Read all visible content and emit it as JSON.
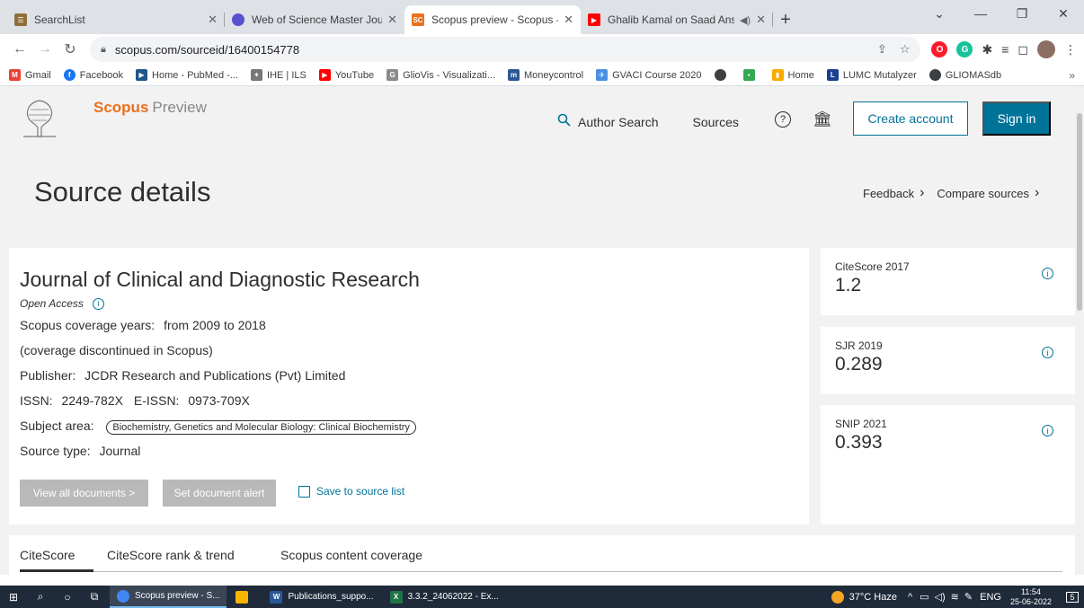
{
  "browser": {
    "tabs": [
      {
        "title": "SearchList",
        "favicon": "searchlist-icon",
        "favicon_color": "#8e6f3a",
        "active": false
      },
      {
        "title": "Web of Science Master Journal Li",
        "favicon": "globe-icon",
        "favicon_color": "#5a4fcf",
        "active": false
      },
      {
        "title": "Scopus preview - Scopus - Journ",
        "favicon": "scopus-icon",
        "favicon_color": "#e9711c",
        "active": true
      },
      {
        "title": "Ghalib Kamal on Saad Ansar",
        "favicon": "youtube-icon",
        "favicon_color": "#ff0000",
        "active": false
      }
    ],
    "favicon_text_scopus": "SC",
    "address": "scopus.com/sourceid/16400154778",
    "bookmarks": [
      {
        "label": "Gmail",
        "icon": "gmail-icon",
        "color": "#ea4335"
      },
      {
        "label": "Facebook",
        "icon": "facebook-icon",
        "color": "#1877f2"
      },
      {
        "label": "Home - PubMed -...",
        "icon": "pubmed-icon",
        "color": "#20558a"
      },
      {
        "label": "IHE | ILS",
        "icon": "ihe-icon",
        "color": "#777777"
      },
      {
        "label": "YouTube",
        "icon": "youtube-icon",
        "color": "#ff0000"
      },
      {
        "label": "GlioVis - Visualizati...",
        "icon": "gliovis-icon",
        "color": "#8a8a8a"
      },
      {
        "label": "Moneycontrol",
        "icon": "moneycontrol-icon",
        "color": "#2b5797"
      },
      {
        "label": "GVACI Course 2020",
        "icon": "gvaci-icon",
        "color": "#4a90e2"
      },
      {
        "label": "",
        "icon": "globe-icon",
        "color": "#3c4043"
      },
      {
        "label": "",
        "icon": "apps-icon",
        "color": "#34a853"
      },
      {
        "label": "Home",
        "icon": "analytics-icon",
        "color": "#f9ab00"
      },
      {
        "label": "LUMC Mutalyzer",
        "icon": "lumc-icon",
        "color": "#1a3f8f"
      },
      {
        "label": "GLIOMASdb",
        "icon": "globe-icon",
        "color": "#3c4043"
      }
    ],
    "bookmarks_more": "»"
  },
  "header": {
    "brand": "Scopus",
    "brand_sub": "Preview",
    "author_search": "Author Search",
    "sources": "Sources",
    "create_account": "Create account",
    "sign_in": "Sign in",
    "accent": "#007398",
    "brand_color": "#e9711c"
  },
  "page": {
    "title": "Source details",
    "feedback": "Feedback",
    "compare": "Compare sources"
  },
  "journal": {
    "name": "Journal of Clinical and Diagnostic Research",
    "open_access": "Open Access",
    "coverage_label": "Scopus coverage years:",
    "coverage_value": "from 2009 to 2018",
    "discontinued": "(coverage discontinued in Scopus)",
    "publisher_label": "Publisher:",
    "publisher_value": "JCDR Research and Publications (Pvt) Limited",
    "issn_label": "ISSN:",
    "issn_value": "2249-782X",
    "eissn_label": "E-ISSN:",
    "eissn_value": "0973-709X",
    "subject_label": "Subject area:",
    "subject_value": "Biochemistry, Genetics and Molecular Biology: Clinical Biochemistry",
    "source_type_label": "Source type:",
    "source_type_value": "Journal",
    "btn_view_all": "View all documents >",
    "btn_alert": "Set document alert",
    "btn_save": "Save to source list"
  },
  "metrics": [
    {
      "label": "CiteScore 2017",
      "value": "1.2"
    },
    {
      "label": "SJR 2019",
      "value": "0.289"
    },
    {
      "label": "SNIP 2021",
      "value": "0.393"
    }
  ],
  "bottom_tabs": [
    "CiteScore",
    "CiteScore rank & trend",
    "Scopus content coverage"
  ],
  "taskbar": {
    "apps": [
      {
        "label": "Scopus preview - S...",
        "icon": "chrome-icon",
        "color": "#4285f4",
        "active": true
      },
      {
        "label": "",
        "icon": "file-explorer-icon",
        "color": "#f4b400",
        "active": false
      },
      {
        "label": "Publications_suppo...",
        "icon": "word-icon",
        "color": "#2b579a",
        "active": false
      },
      {
        "label": "3.3.2_24062022 - Ex...",
        "icon": "excel-icon",
        "color": "#217346",
        "active": false
      }
    ],
    "weather": "37°C  Haze",
    "lang": "ENG",
    "time": "11:54",
    "date": "25-06-2022",
    "notification_count": "5"
  }
}
